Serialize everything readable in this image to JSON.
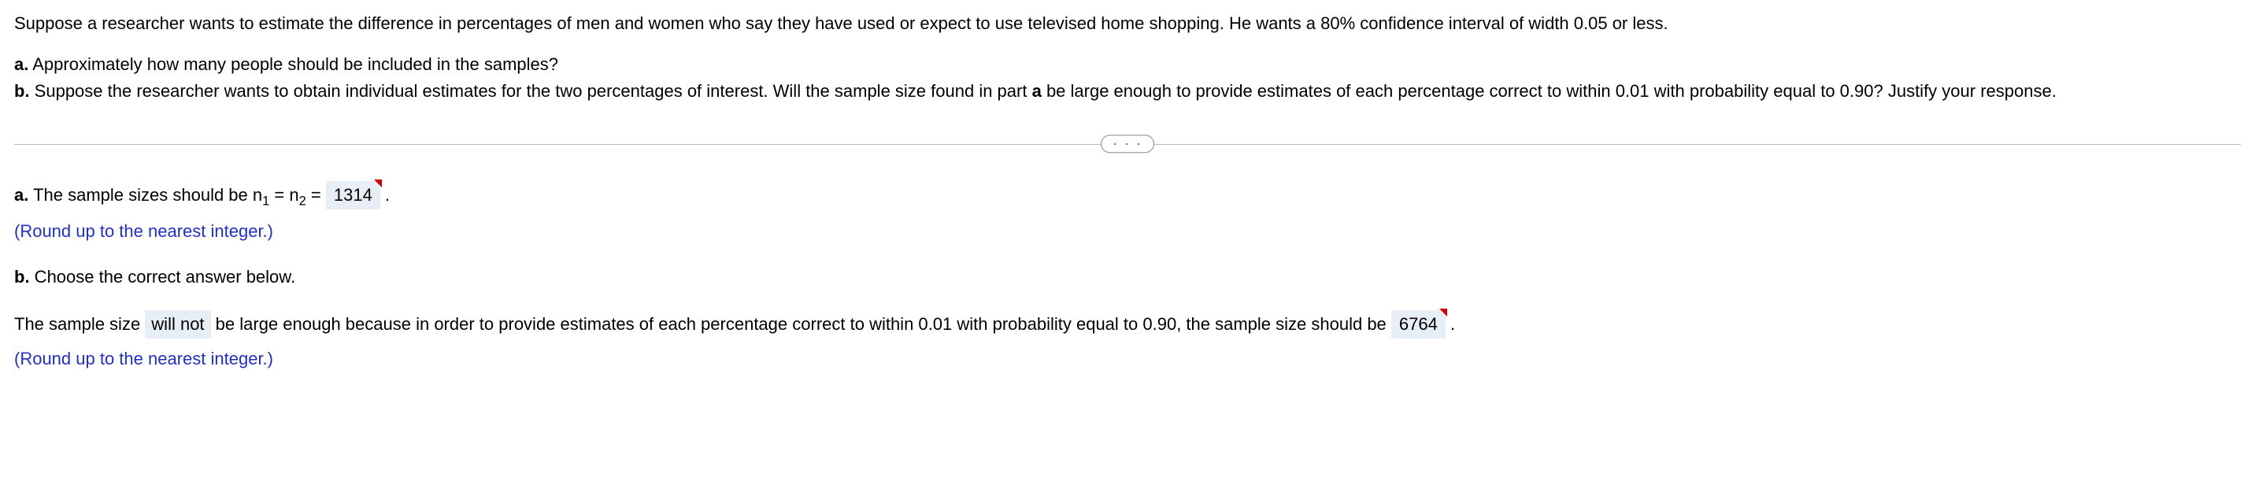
{
  "question": {
    "intro": "Suppose a researcher wants to estimate the difference in percentages of men and women who say they have used or expect to use televised home shopping. He wants a 80% confidence interval of width 0.05 or less.",
    "part_a_label": "a.",
    "part_a_text": " Approximately how many people should be included in the samples?",
    "part_b_label": "b.",
    "part_b_text": " Suppose the researcher wants to obtain individual estimates for the two percentages of interest. Will the sample size found in part ",
    "part_b_bold": "a",
    "part_b_text2": " be large enough to provide estimates of each percentage correct to within 0.01 with probability equal to 0.90? Justify your response."
  },
  "separator_dots": "· · ·",
  "answer_a": {
    "label": "a.",
    "text_before": " The sample sizes should be n",
    "sub1": "1",
    "eq1": " = n",
    "sub2": "2",
    "eq2": " = ",
    "value": "1314",
    "text_after": " ."
  },
  "hint_a": "(Round up to the nearest integer.)",
  "answer_b_label": {
    "label": "b.",
    "text": " Choose the correct answer below."
  },
  "answer_b": {
    "text_before": "The sample size ",
    "select_value": " will not ",
    "text_mid": " be large enough because in order to provide estimates of each percentage correct to within 0.01 with probability equal to 0.90, the sample size should be ",
    "value": "6764",
    "text_after": " ."
  },
  "hint_b": "(Round up to the nearest integer.)"
}
